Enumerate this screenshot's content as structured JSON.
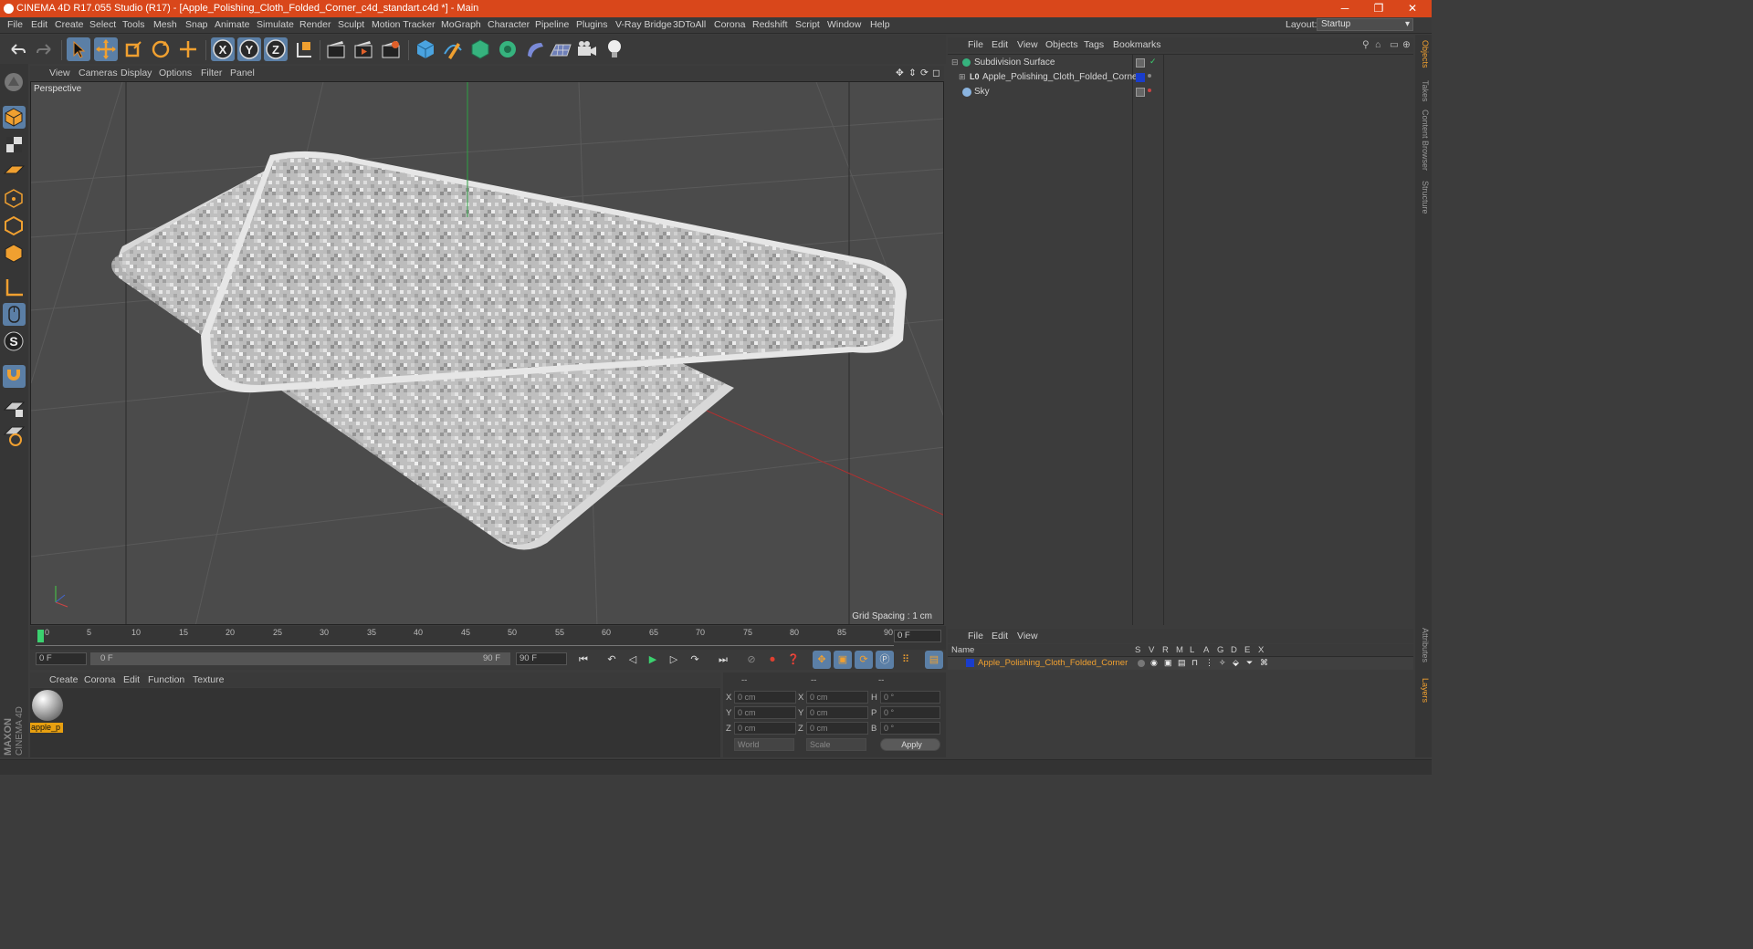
{
  "window": {
    "title": "CINEMA 4D R17.055 Studio (R17) - [Apple_Polishing_Cloth_Folded_Corner_c4d_standart.c4d *] - Main",
    "minimize_glyph": "─",
    "restore_glyph": "❐",
    "close_glyph": "✕"
  },
  "menu": [
    "File",
    "Edit",
    "Create",
    "Select",
    "Tools",
    "Mesh",
    "Snap",
    "Animate",
    "Simulate",
    "Render",
    "Sculpt",
    "Motion Tracker",
    "MoGraph",
    "Character",
    "Pipeline",
    "Plugins",
    "V-Ray Bridge",
    "3DToAll",
    "Corona",
    "Redshift",
    "Script",
    "Window",
    "Help"
  ],
  "layout": {
    "label": "Layout:",
    "value": "Startup"
  },
  "toolbar_axes": [
    "X",
    "Y",
    "Z"
  ],
  "viewport": {
    "menu": [
      "View",
      "Cameras",
      "Display",
      "Options",
      "Filter",
      "Panel"
    ],
    "label": "Perspective",
    "grid_spacing": "Grid Spacing : 1 cm",
    "accent_x": "#c0392b",
    "accent_y": "#27ae60"
  },
  "timeline": {
    "ticks": [
      "0",
      "5",
      "10",
      "15",
      "20",
      "25",
      "30",
      "35",
      "40",
      "45",
      "50",
      "55",
      "60",
      "65",
      "70",
      "75",
      "80",
      "85",
      "90"
    ],
    "current_frame": "0 F",
    "start_field": "0 F",
    "range_start": "0 F",
    "range_end": "90 F",
    "end_field": "90 F"
  },
  "materials": {
    "menu": [
      "Create",
      "Corona",
      "Edit",
      "Function",
      "Texture"
    ],
    "items": [
      {
        "name": "apple_p"
      }
    ]
  },
  "coordinates": {
    "headers": [
      "--",
      "--",
      "--"
    ],
    "rows": [
      {
        "a": "X",
        "a_val": "0 cm",
        "b": "X",
        "b_val": "0 cm",
        "c": "H",
        "c_val": "0 °"
      },
      {
        "a": "Y",
        "a_val": "0 cm",
        "b": "Y",
        "b_val": "0 cm",
        "c": "P",
        "c_val": "0 °"
      },
      {
        "a": "Z",
        "a_val": "0 cm",
        "b": "Z",
        "b_val": "0 cm",
        "c": "B",
        "c_val": "0 °"
      }
    ],
    "mode": "World",
    "transform": "Scale",
    "apply_label": "Apply"
  },
  "object_manager": {
    "menu": [
      "File",
      "Edit",
      "View",
      "Objects",
      "Tags",
      "Bookmarks"
    ],
    "objects": [
      {
        "name": "Subdivision Surface"
      },
      {
        "name": "Apple_Polishing_Cloth_Folded_Corner"
      },
      {
        "name": "Sky"
      }
    ]
  },
  "layer_manager": {
    "menu": [
      "File",
      "Edit",
      "View"
    ],
    "columns": [
      "Name",
      "S",
      "V",
      "R",
      "M",
      "L",
      "A",
      "G",
      "D",
      "E",
      "X"
    ],
    "layers": [
      {
        "name": "Apple_Polishing_Cloth_Folded_Corner",
        "color": "#1a3dcc"
      }
    ]
  },
  "right_tabs": [
    "Objects",
    "Takes",
    "Content Browser",
    "Structure",
    "Attributes",
    "Layers"
  ],
  "brand": {
    "line1": "MAXON",
    "line2": "CINEMA 4D"
  }
}
